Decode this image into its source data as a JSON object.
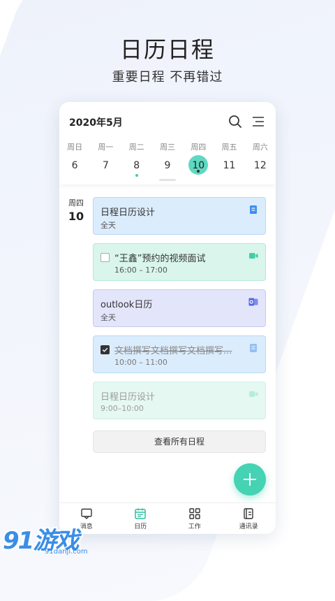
{
  "hero": {
    "title": "日历日程",
    "subtitle": "重要日程 不再错过"
  },
  "calendar": {
    "month_label": "2020年5月",
    "weekdays": [
      "周日",
      "周一",
      "周二",
      "周三",
      "周四",
      "周五",
      "周六"
    ],
    "dates": [
      "6",
      "7",
      "8",
      "9",
      "10",
      "11",
      "12"
    ],
    "selected_date": "10"
  },
  "day": {
    "weekday": "周四",
    "date": "10"
  },
  "events": [
    {
      "title": "日程日历设计",
      "sub": "全天",
      "color": "#dbecfd",
      "icon": "note-icon"
    },
    {
      "title": "“王鑫”预约的视频面试",
      "sub": "16:00 – 17:00",
      "color": "#d9f5ec",
      "icon": "video-icon",
      "checked": false
    },
    {
      "title": "outlook日历",
      "sub": "全天",
      "color": "#e3e5fb",
      "icon": "outlook-icon"
    },
    {
      "title": "文档撰写文档撰写文档撰写...",
      "sub": "10:00 – 11:00",
      "color": "#dbecfd",
      "icon": "note-icon",
      "checked": true
    },
    {
      "title": "日程日历设计",
      "sub": "9:00–10:00",
      "color": "#d9f5ec",
      "icon": "video-icon"
    }
  ],
  "view_all_label": "查看所有日程",
  "tabs": [
    {
      "label": "消息",
      "icon": "message-icon"
    },
    {
      "label": "日历",
      "icon": "calendar-icon"
    },
    {
      "label": "工作",
      "icon": "grid-icon"
    },
    {
      "label": "通讯录",
      "icon": "contacts-icon"
    }
  ],
  "watermark": {
    "logo": "91游戏",
    "url": "91danji.com"
  },
  "colors": {
    "accent": "#45d3b4",
    "selected": "#5fd8c1",
    "brand_blue": "#3a8ee6"
  }
}
